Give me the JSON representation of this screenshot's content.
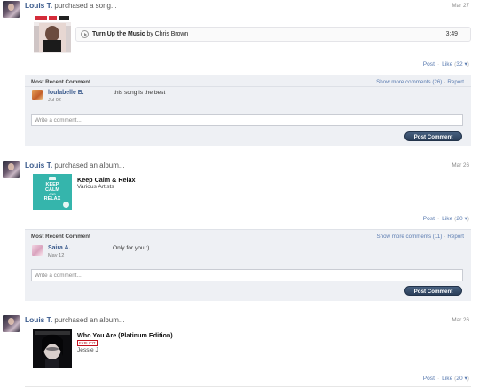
{
  "feed": [
    {
      "user": "Louis T.",
      "action": "purchased a song...",
      "date": "Mar 27",
      "track": {
        "title": "Turn Up the Music",
        "by_label": "by",
        "artist": "Chris Brown",
        "duration": "3:49"
      },
      "actions": {
        "post": "Post",
        "like": "Like",
        "count": "32"
      },
      "comments": {
        "header": "Most Recent Comment",
        "more": "Show more comments (26)",
        "report": "Report",
        "latest": {
          "name": "loulabelle B.",
          "date": "Jul 02",
          "text": "this song is the best"
        },
        "input_placeholder": "Write a comment...",
        "submit": "Post Comment"
      }
    },
    {
      "user": "Louis T.",
      "action": "purchased an album...",
      "date": "Mar 26",
      "album": {
        "title": "Keep Calm & Relax",
        "artist": "Various Artists",
        "cover_text": [
          "KEEP",
          "CALM",
          "AND",
          "RELAX"
        ]
      },
      "actions": {
        "post": "Post",
        "like": "Like",
        "count": "20"
      },
      "comments": {
        "header": "Most Recent Comment",
        "more": "Show more comments (11)",
        "report": "Report",
        "latest": {
          "name": "Saira A.",
          "date": "May 12",
          "text": "Only for you :)"
        },
        "input_placeholder": "Write a comment...",
        "submit": "Post Comment"
      }
    },
    {
      "user": "Louis T.",
      "action": "purchased an album...",
      "date": "Mar 26",
      "album": {
        "title": "Who You Are (Platinum Edition)",
        "explicit": "EXPLICIT",
        "artist": "Jessie J"
      },
      "actions": {
        "post": "Post",
        "like": "Like",
        "count": "20"
      }
    }
  ],
  "colors": {
    "link": "#5a7bb0",
    "username": "#3a5a8c",
    "comment_bg": "#eef0f4",
    "button": "#2b3f5a",
    "keep_calm_teal": "#35b5ac",
    "explicit": "#c1121f"
  }
}
